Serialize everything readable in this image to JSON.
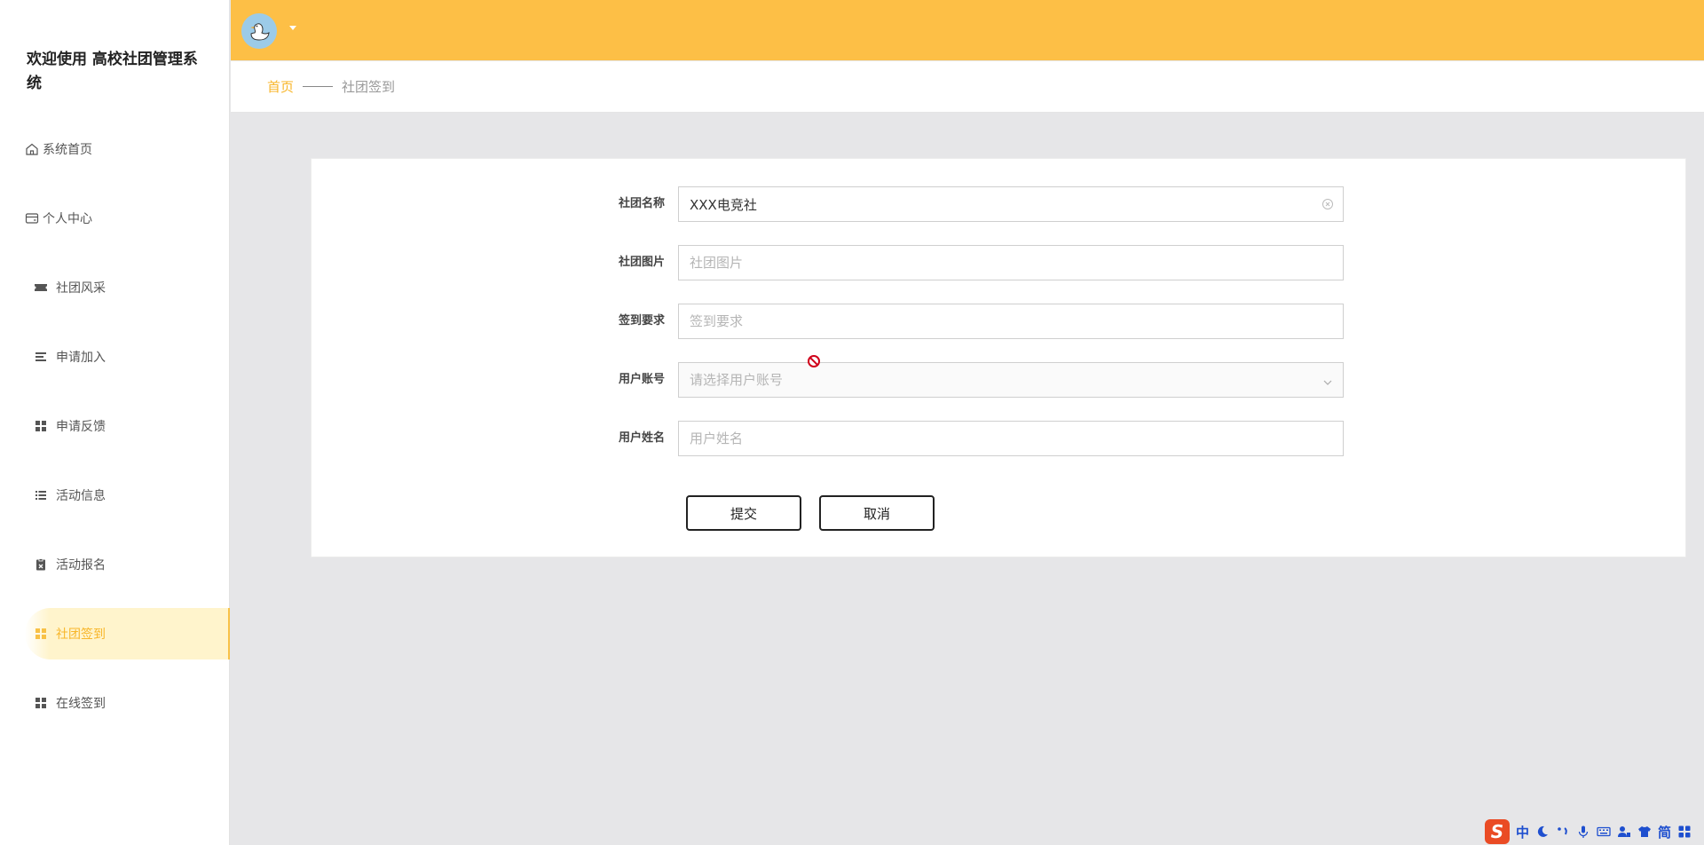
{
  "sidebar": {
    "title": "欢迎使用 高校社团管理系统",
    "items": [
      {
        "label": "系统首页",
        "icon": "home-icon"
      },
      {
        "label": "个人中心",
        "icon": "wallet-icon"
      },
      {
        "label": "社团风采",
        "icon": "ticket-icon"
      },
      {
        "label": "申请加入",
        "icon": "lines-icon"
      },
      {
        "label": "申请反馈",
        "icon": "grid-icon"
      },
      {
        "label": "活动信息",
        "icon": "list-icon"
      },
      {
        "label": "活动报名",
        "icon": "clipboard-icon"
      },
      {
        "label": "社团签到",
        "icon": "grid-icon",
        "active": true
      },
      {
        "label": "在线签到",
        "icon": "grid-icon"
      }
    ]
  },
  "header": {
    "accent_color": "#fdbf46",
    "avatar_icon": "duck-avatar-icon"
  },
  "breadcrumb": {
    "home": "首页",
    "current": "社团签到"
  },
  "form": {
    "fields": [
      {
        "label": "社团名称",
        "value": "XXX电竞社",
        "placeholder": ""
      },
      {
        "label": "社团图片",
        "value": "",
        "placeholder": "社团图片"
      },
      {
        "label": "签到要求",
        "value": "",
        "placeholder": "签到要求"
      },
      {
        "label": "用户账号",
        "value": "",
        "placeholder": "请选择用户账号"
      },
      {
        "label": "用户姓名",
        "value": "",
        "placeholder": "用户姓名"
      }
    ],
    "submit_label": "提交",
    "cancel_label": "取消"
  },
  "ime": {
    "mode": "中",
    "simplified": "简"
  }
}
